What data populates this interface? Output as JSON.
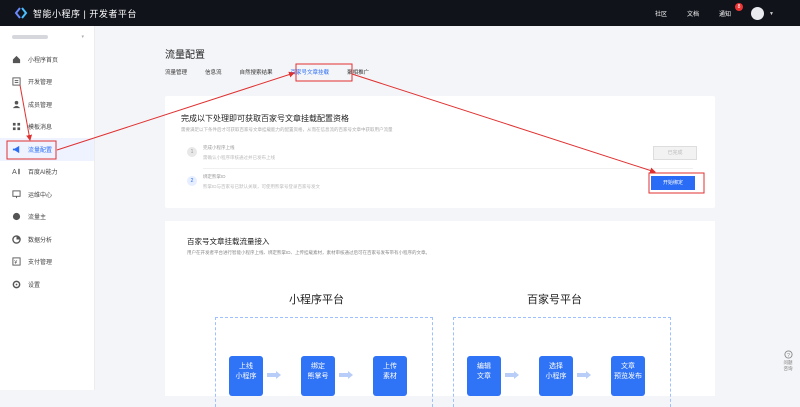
{
  "topbar": {
    "logo_text": "智能小程序 | 开发者平台",
    "links": [
      "社区",
      "文档",
      "通知"
    ],
    "notice_count": "8"
  },
  "sidebar": {
    "items": [
      {
        "label": "小程序首页",
        "icon": "home-icon"
      },
      {
        "label": "开发管理",
        "icon": "code-icon"
      },
      {
        "label": "成员管理",
        "icon": "user-icon"
      },
      {
        "label": "模板消息",
        "icon": "grid-icon"
      },
      {
        "label": "流量配置",
        "icon": "megaphone-icon"
      },
      {
        "label": "百度AI能力",
        "icon": "ai-icon"
      },
      {
        "label": "运维中心",
        "icon": "monitor-icon"
      },
      {
        "label": "流量主",
        "icon": "coin-icon"
      },
      {
        "label": "数据分析",
        "icon": "chart-icon"
      },
      {
        "label": "支付管理",
        "icon": "pay-icon"
      },
      {
        "label": "设置",
        "icon": "gear-icon"
      }
    ],
    "active_index": 4
  },
  "page": {
    "title": "流量配置",
    "tabs": [
      "流量管理",
      "信息流",
      "自然搜索结果",
      "百家号文章挂载",
      "聚相推广"
    ],
    "active_tab": 3
  },
  "card1": {
    "title": "完成以下处理即可获取百家号文章挂载配置资格",
    "subtitle": "需要满足以下条件后才可获取百家号文章挂载能力的配置资格，从而在信息流的百家号文章中获取用户流量",
    "steps": [
      {
        "num": "1",
        "title": "完成小程序上线",
        "desc": "需确认小程序审核通过并已发布上线",
        "button": "已完成"
      },
      {
        "num": "2",
        "title": "绑定熊掌ID",
        "desc": "熊掌ID与百家号已默认关联，可使用熊掌号登录百家号发文",
        "button": "开始绑定"
      }
    ]
  },
  "card2": {
    "title": "百家号文章挂载流量接入",
    "subtitle": "用户在开发者平台进行智能小程序上线、绑定熊掌ID、上传挂载素材，素材审核通过后可在百家号发布带有小程序的文章。",
    "platform_left": "小程序平台",
    "platform_right": "百家号平台",
    "boxes": [
      "上线\n小程序",
      "绑定\n熊掌号",
      "上传\n素材",
      "编辑\n文章",
      "选择\n小程序",
      "文章\n预览发布"
    ]
  },
  "help": {
    "label": "问题\n咨询"
  },
  "colors": {
    "accent": "#2a6cf6",
    "annotation": "#e03030",
    "topbar": "#101319"
  }
}
